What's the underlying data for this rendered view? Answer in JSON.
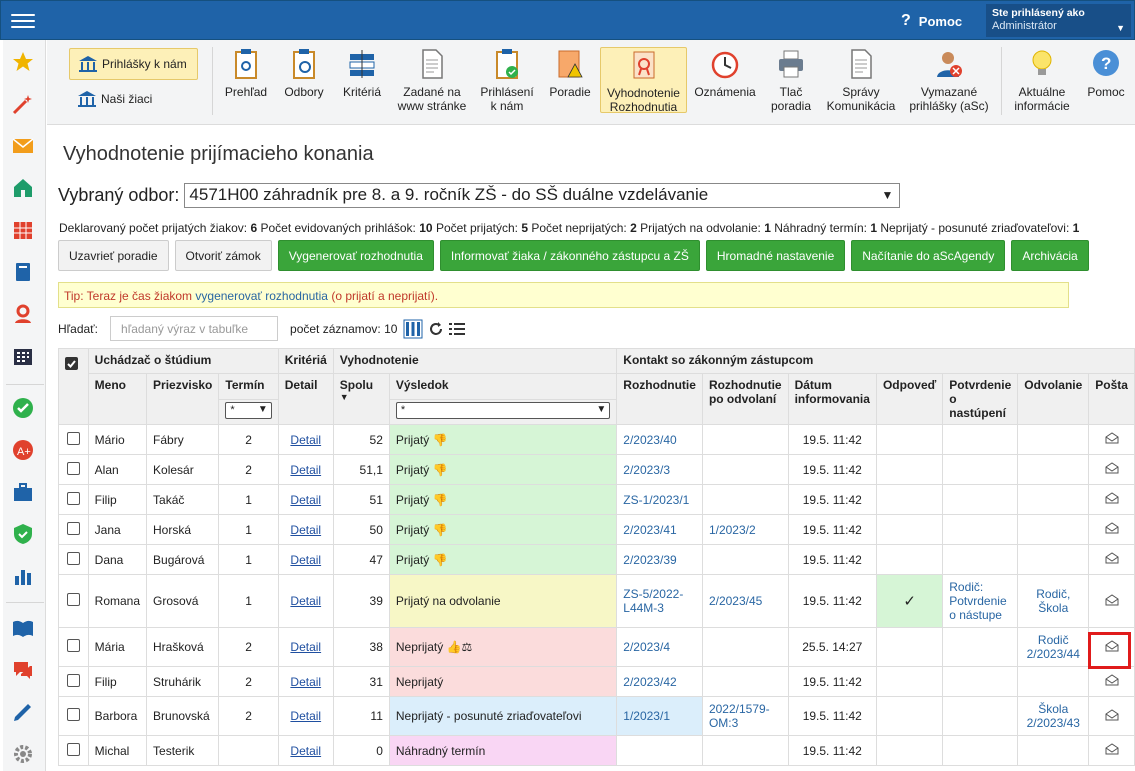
{
  "header": {
    "help_label": "Pomoc",
    "user_line1": "Ste prihlásený ako",
    "user_line2": "Administrátor"
  },
  "toolbar": {
    "left_btn1": "Prihlášky k nám",
    "left_btn2": "Naši žiaci",
    "items": [
      "Prehľad",
      "Odbory",
      "Kritériá",
      "Zadané na",
      "www stránke",
      "Prihlásení",
      "k nám",
      "Poradie",
      "Vyhodnotenie",
      "Rozhodnutia",
      "Oznámenia",
      "Tlač",
      "poradia",
      "Správy",
      "Komunikácia",
      "Vymazané",
      "prihlášky (aSc)",
      "Aktuálne",
      "informácie",
      "Pomoc"
    ]
  },
  "page": {
    "title": "Vyhodnotenie prijímacieho konania",
    "odbor_label": "Vybraný odbor:",
    "odbor_value": "4571H00 záhradník pre 8. a 9. ročník ZŠ - do SŠ duálne vzdelávanie",
    "stats": {
      "l1": "Deklarovaný počet prijatých žiakov:",
      "v1": "6",
      "l2": "Počet evidovaných prihlášok:",
      "v2": "10",
      "l3": "Počet prijatých:",
      "v3": "5",
      "l4": "Počet neprijatých:",
      "v4": "2",
      "l5": "Prijatých na odvolanie:",
      "v5": "1",
      "l6": "Náhradný termín:",
      "v6": "1",
      "l7": "Neprijatý - posunuté zriaďovateľovi:",
      "v7": "1"
    },
    "buttons": [
      "Uzavrieť poradie",
      "Otvoriť zámok",
      "Vygenerovať rozhodnutia",
      "Informovať žiaka / zákonného zástupcu a ZŠ",
      "Hromadné nastavenie",
      "Načítanie do aScAgendy",
      "Archivácia"
    ],
    "tip_prefix": "Tip: Teraz je čas žiakom ",
    "tip_link": "vygenerovať rozhodnutia",
    "tip_suffix": " (o prijatí a neprijatí).",
    "search_label": "Hľadať:",
    "search_placeholder": "hľadaný výraz v tabuľke",
    "records_label": "počet záznamov: 10"
  },
  "table": {
    "groups": {
      "applicant": "Uchádzač o štúdium",
      "criteria": "Kritériá",
      "evaluation": "Vyhodnotenie",
      "contact": "Kontakt so zákonným zástupcom"
    },
    "cols": {
      "meno": "Meno",
      "priezvisko": "Priezvisko",
      "termin": "Termín",
      "detail": "Detail",
      "spolu": "Spolu",
      "vysledok": "Výsledok",
      "rozh": "Rozhodnutie",
      "rozh_odv1": "Rozhodnutie",
      "rozh_odv2": "po odvolaní",
      "datum1": "Dátum",
      "datum2": "informovania",
      "odpoved": "Odpoveď",
      "potvr1": "Potvrdenie",
      "potvr2": "o",
      "potvr3": "nastúpení",
      "odvolanie": "Odvolanie",
      "posta": "Pošta",
      "filter": "*"
    },
    "rows": [
      {
        "meno": "Mário",
        "priezvisko": "Fábry",
        "termin": "2",
        "detail": "Detail",
        "spolu": "52",
        "vysledok": "Prijatý",
        "rozh": "2/2023/40",
        "rozh_odv": "",
        "datum": "19.5. 11:42",
        "odpoved": "",
        "potvr": "",
        "odv1": "",
        "odv2": ""
      },
      {
        "meno": "Alan",
        "priezvisko": "Kolesár",
        "termin": "2",
        "detail": "Detail",
        "spolu": "51,1",
        "vysledok": "Prijatý",
        "rozh": "2/2023/3",
        "rozh_odv": "",
        "datum": "19.5. 11:42",
        "odpoved": "",
        "potvr": "",
        "odv1": "",
        "odv2": ""
      },
      {
        "meno": "Filip",
        "priezvisko": "Takáč",
        "termin": "1",
        "detail": "Detail",
        "spolu": "51",
        "vysledok": "Prijatý",
        "rozh": "ZS-1/2023/1",
        "rozh_odv": "",
        "datum": "19.5. 11:42",
        "odpoved": "",
        "potvr": "",
        "odv1": "",
        "odv2": ""
      },
      {
        "meno": "Jana",
        "priezvisko": "Horská",
        "termin": "1",
        "detail": "Detail",
        "spolu": "50",
        "vysledok": "Prijatý",
        "rozh": "2/2023/41",
        "rozh_odv": "1/2023/2",
        "datum": "19.5. 11:42",
        "odpoved": "",
        "potvr": "",
        "odv1": "",
        "odv2": ""
      },
      {
        "meno": "Dana",
        "priezvisko": "Bugárová",
        "termin": "1",
        "detail": "Detail",
        "spolu": "47",
        "vysledok": "Prijatý",
        "rozh": "2/2023/39",
        "rozh_odv": "",
        "datum": "19.5. 11:42",
        "odpoved": "",
        "potvr": "",
        "odv1": "",
        "odv2": ""
      },
      {
        "meno": "Romana",
        "priezvisko": "Grosová",
        "termin": "1",
        "detail": "Detail",
        "spolu": "39",
        "vysledok": "Prijatý na odvolanie",
        "rozh": "ZS-5/2022-L44M-3",
        "rozh_odv": "2/2023/45",
        "datum": "19.5. 11:42",
        "odpoved": "✓",
        "potvr": "Rodič: Potvrdenie o nástupe",
        "odv1": "Rodič,",
        "odv2": "Škola"
      },
      {
        "meno": "Mária",
        "priezvisko": "Hrašková",
        "termin": "2",
        "detail": "Detail",
        "spolu": "38",
        "vysledok": "Neprijatý",
        "rozh": "2/2023/4",
        "rozh_odv": "",
        "datum": "25.5. 14:27",
        "odpoved": "",
        "potvr": "",
        "odv1": "Rodič",
        "odv2": "2/2023/44"
      },
      {
        "meno": "Filip",
        "priezvisko": "Struhárik",
        "termin": "2",
        "detail": "Detail",
        "spolu": "31",
        "vysledok": "Neprijatý",
        "rozh": "2/2023/42",
        "rozh_odv": "",
        "datum": "19.5. 11:42",
        "odpoved": "",
        "potvr": "",
        "odv1": "",
        "odv2": ""
      },
      {
        "meno": "Barbora",
        "priezvisko": "Brunovská",
        "termin": "2",
        "detail": "Detail",
        "spolu": "11",
        "vysledok": "Neprijatý - posunuté zriaďovateľovi",
        "rozh": "1/2023/1",
        "rozh_odv": "2022/1579-OM:3",
        "datum": "19.5. 11:42",
        "odpoved": "",
        "potvr": "",
        "odv1": "Škola",
        "odv2": "2/2023/43"
      },
      {
        "meno": "Michal",
        "priezvisko": "Testerik",
        "termin": "",
        "detail": "Detail",
        "spolu": "0",
        "vysledok": "Náhradný termín",
        "rozh": "",
        "rozh_odv": "",
        "datum": "19.5. 11:42",
        "odpoved": "",
        "potvr": "",
        "odv1": "",
        "odv2": ""
      }
    ]
  }
}
